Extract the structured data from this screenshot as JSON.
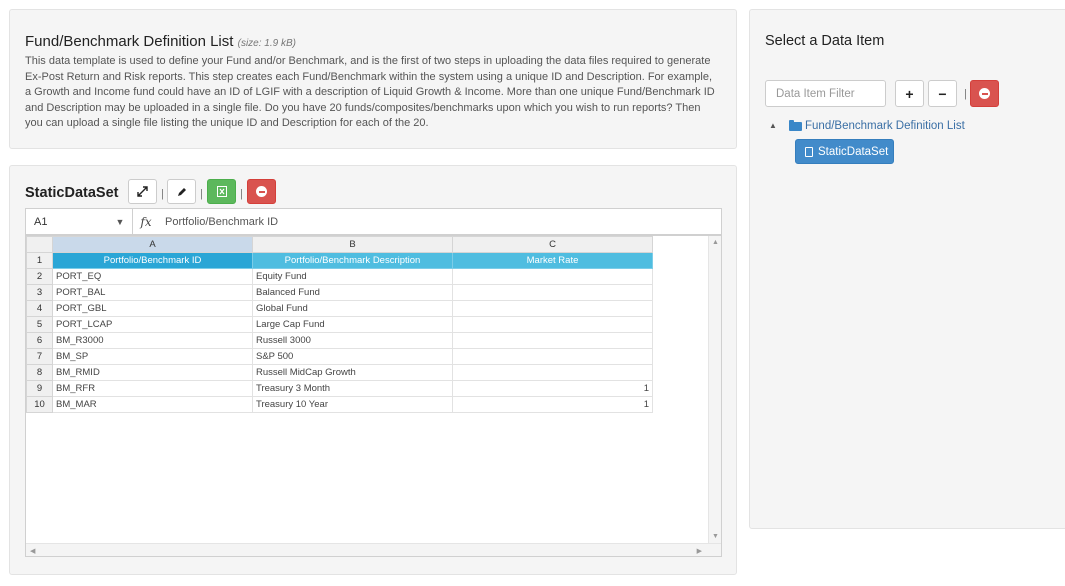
{
  "description": {
    "title": "Fund/Benchmark Definition List",
    "size": "(size: 1.9 kB)",
    "text": "This data template is used to define your Fund and/or Benchmark, and is the first of two steps in uploading the data files required to generate Ex-Post Return and Risk reports. This step creates each Fund/Benchmark within the system using a unique ID and Description. For example, a Growth and Income fund could have an ID of LGIF with a description of Liquid Growth & Income. More than one unique Fund/Benchmark ID and Description may be uploaded in a single file. Do you have 20 funds/composites/benchmarks upon which you wish to run reports? Then you can upload a single file listing the unique ID and Description for each of the 20."
  },
  "sheet": {
    "title": "StaticDataSet",
    "separator": "|",
    "toolbar": {
      "expand_icon": "expand-icon",
      "edit_icon": "pencil-icon",
      "excel_icon": "excel-icon",
      "remove_icon": "minus-circle-icon"
    },
    "formula_bar": {
      "cell_ref": "A1",
      "dropdown": "▼",
      "fx": "fx",
      "value": "Portfolio/Benchmark ID"
    },
    "columns": [
      "A",
      "B",
      "C"
    ],
    "header_row": {
      "row_number": "1",
      "cells": [
        "Portfolio/Benchmark ID",
        "Portfolio/Benchmark Description",
        "Market Rate"
      ]
    },
    "rows": [
      {
        "n": "2",
        "id": "PORT_EQ",
        "desc": "Equity Fund",
        "rate": ""
      },
      {
        "n": "3",
        "id": "PORT_BAL",
        "desc": "Balanced Fund",
        "rate": ""
      },
      {
        "n": "4",
        "id": "PORT_GBL",
        "desc": "Global Fund",
        "rate": ""
      },
      {
        "n": "5",
        "id": "PORT_LCAP",
        "desc": "Large Cap Fund",
        "rate": ""
      },
      {
        "n": "6",
        "id": "BM_R3000",
        "desc": "Russell 3000",
        "rate": ""
      },
      {
        "n": "7",
        "id": "BM_SP",
        "desc": "S&P 500",
        "rate": ""
      },
      {
        "n": "8",
        "id": "BM_RMID",
        "desc": "Russell MidCap Growth",
        "rate": ""
      },
      {
        "n": "9",
        "id": "BM_RFR",
        "desc": "Treasury 3 Month",
        "rate": "1"
      },
      {
        "n": "10",
        "id": "BM_MAR",
        "desc": "Treasury 10 Year",
        "rate": "1"
      }
    ],
    "colors": {
      "header_fill": "#4fbde0",
      "excel_button": "#5cb85c",
      "remove_button": "#d9534f"
    }
  },
  "data_item": {
    "title": "Select a Data Item",
    "filter_placeholder": "Data Item Filter",
    "add_label": "+",
    "collapse_label": "−",
    "separator": "|",
    "tree": {
      "toggle": "▲",
      "folder_label": "Fund/Benchmark Definition List",
      "item_label": "StaticDataSet"
    },
    "colors": {
      "selected_item": "#428bca",
      "folder_link": "#3a6fa5"
    }
  }
}
